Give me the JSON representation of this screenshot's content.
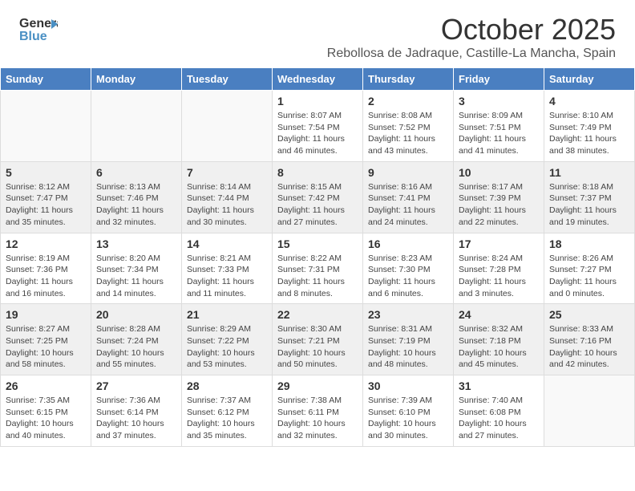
{
  "header": {
    "logo_line1": "General",
    "logo_line2": "Blue",
    "month_title": "October 2025",
    "location": "Rebollosa de Jadraque, Castille-La Mancha, Spain"
  },
  "days_of_week": [
    "Sunday",
    "Monday",
    "Tuesday",
    "Wednesday",
    "Thursday",
    "Friday",
    "Saturday"
  ],
  "weeks": [
    [
      {
        "day": "",
        "info": ""
      },
      {
        "day": "",
        "info": ""
      },
      {
        "day": "",
        "info": ""
      },
      {
        "day": "1",
        "info": "Sunrise: 8:07 AM\nSunset: 7:54 PM\nDaylight: 11 hours and 46 minutes."
      },
      {
        "day": "2",
        "info": "Sunrise: 8:08 AM\nSunset: 7:52 PM\nDaylight: 11 hours and 43 minutes."
      },
      {
        "day": "3",
        "info": "Sunrise: 8:09 AM\nSunset: 7:51 PM\nDaylight: 11 hours and 41 minutes."
      },
      {
        "day": "4",
        "info": "Sunrise: 8:10 AM\nSunset: 7:49 PM\nDaylight: 11 hours and 38 minutes."
      }
    ],
    [
      {
        "day": "5",
        "info": "Sunrise: 8:12 AM\nSunset: 7:47 PM\nDaylight: 11 hours and 35 minutes."
      },
      {
        "day": "6",
        "info": "Sunrise: 8:13 AM\nSunset: 7:46 PM\nDaylight: 11 hours and 32 minutes."
      },
      {
        "day": "7",
        "info": "Sunrise: 8:14 AM\nSunset: 7:44 PM\nDaylight: 11 hours and 30 minutes."
      },
      {
        "day": "8",
        "info": "Sunrise: 8:15 AM\nSunset: 7:42 PM\nDaylight: 11 hours and 27 minutes."
      },
      {
        "day": "9",
        "info": "Sunrise: 8:16 AM\nSunset: 7:41 PM\nDaylight: 11 hours and 24 minutes."
      },
      {
        "day": "10",
        "info": "Sunrise: 8:17 AM\nSunset: 7:39 PM\nDaylight: 11 hours and 22 minutes."
      },
      {
        "day": "11",
        "info": "Sunrise: 8:18 AM\nSunset: 7:37 PM\nDaylight: 11 hours and 19 minutes."
      }
    ],
    [
      {
        "day": "12",
        "info": "Sunrise: 8:19 AM\nSunset: 7:36 PM\nDaylight: 11 hours and 16 minutes."
      },
      {
        "day": "13",
        "info": "Sunrise: 8:20 AM\nSunset: 7:34 PM\nDaylight: 11 hours and 14 minutes."
      },
      {
        "day": "14",
        "info": "Sunrise: 8:21 AM\nSunset: 7:33 PM\nDaylight: 11 hours and 11 minutes."
      },
      {
        "day": "15",
        "info": "Sunrise: 8:22 AM\nSunset: 7:31 PM\nDaylight: 11 hours and 8 minutes."
      },
      {
        "day": "16",
        "info": "Sunrise: 8:23 AM\nSunset: 7:30 PM\nDaylight: 11 hours and 6 minutes."
      },
      {
        "day": "17",
        "info": "Sunrise: 8:24 AM\nSunset: 7:28 PM\nDaylight: 11 hours and 3 minutes."
      },
      {
        "day": "18",
        "info": "Sunrise: 8:26 AM\nSunset: 7:27 PM\nDaylight: 11 hours and 0 minutes."
      }
    ],
    [
      {
        "day": "19",
        "info": "Sunrise: 8:27 AM\nSunset: 7:25 PM\nDaylight: 10 hours and 58 minutes."
      },
      {
        "day": "20",
        "info": "Sunrise: 8:28 AM\nSunset: 7:24 PM\nDaylight: 10 hours and 55 minutes."
      },
      {
        "day": "21",
        "info": "Sunrise: 8:29 AM\nSunset: 7:22 PM\nDaylight: 10 hours and 53 minutes."
      },
      {
        "day": "22",
        "info": "Sunrise: 8:30 AM\nSunset: 7:21 PM\nDaylight: 10 hours and 50 minutes."
      },
      {
        "day": "23",
        "info": "Sunrise: 8:31 AM\nSunset: 7:19 PM\nDaylight: 10 hours and 48 minutes."
      },
      {
        "day": "24",
        "info": "Sunrise: 8:32 AM\nSunset: 7:18 PM\nDaylight: 10 hours and 45 minutes."
      },
      {
        "day": "25",
        "info": "Sunrise: 8:33 AM\nSunset: 7:16 PM\nDaylight: 10 hours and 42 minutes."
      }
    ],
    [
      {
        "day": "26",
        "info": "Sunrise: 7:35 AM\nSunset: 6:15 PM\nDaylight: 10 hours and 40 minutes."
      },
      {
        "day": "27",
        "info": "Sunrise: 7:36 AM\nSunset: 6:14 PM\nDaylight: 10 hours and 37 minutes."
      },
      {
        "day": "28",
        "info": "Sunrise: 7:37 AM\nSunset: 6:12 PM\nDaylight: 10 hours and 35 minutes."
      },
      {
        "day": "29",
        "info": "Sunrise: 7:38 AM\nSunset: 6:11 PM\nDaylight: 10 hours and 32 minutes."
      },
      {
        "day": "30",
        "info": "Sunrise: 7:39 AM\nSunset: 6:10 PM\nDaylight: 10 hours and 30 minutes."
      },
      {
        "day": "31",
        "info": "Sunrise: 7:40 AM\nSunset: 6:08 PM\nDaylight: 10 hours and 27 minutes."
      },
      {
        "day": "",
        "info": ""
      }
    ]
  ]
}
